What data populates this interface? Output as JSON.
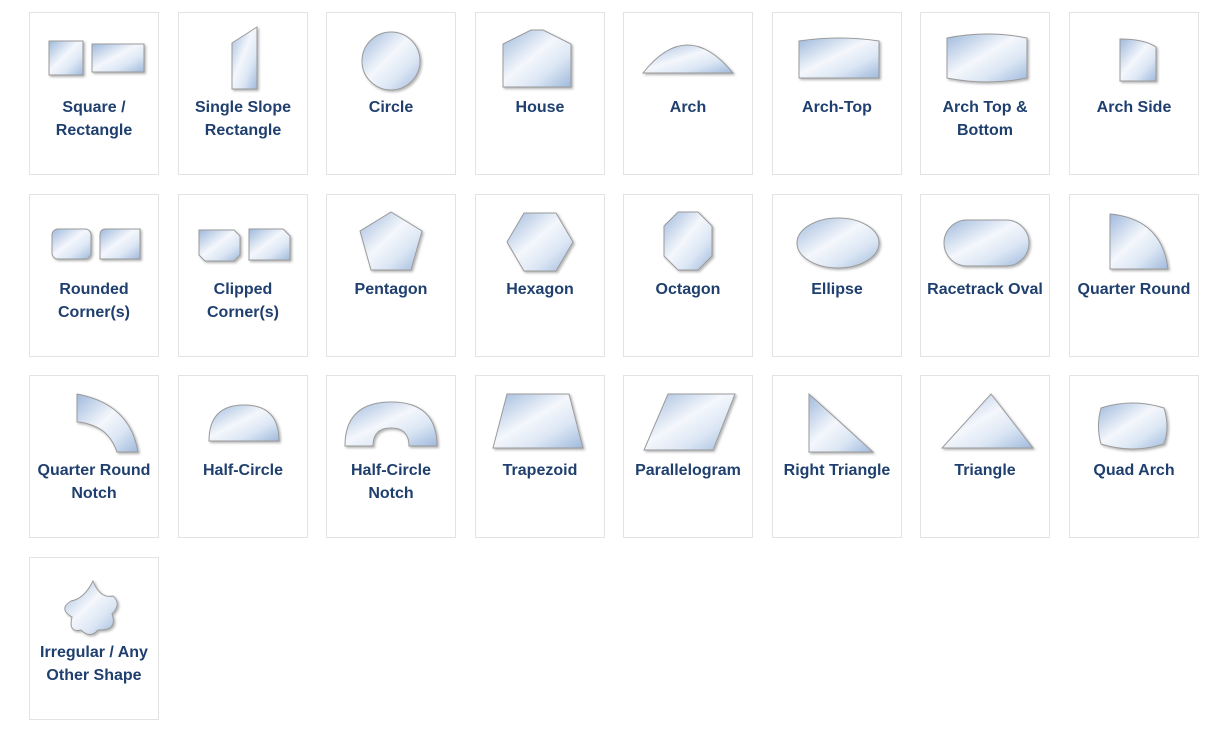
{
  "colors": {
    "label": "#1f3f6e",
    "glass_light": "#f4f7fc",
    "glass_mid": "#dbe6f4",
    "glass_dark": "#9fb9dc",
    "outline": "#9a9a9a"
  },
  "shapes": [
    {
      "id": "square-rectangle",
      "label_lines": [
        "Square /",
        "Rectangle"
      ],
      "icon": "square-rectangle-icon"
    },
    {
      "id": "single-slope-rectangle",
      "label_lines": [
        "Single Slope",
        "Rectangle"
      ],
      "icon": "single-slope-rectangle-icon"
    },
    {
      "id": "circle",
      "label_lines": [
        "Circle"
      ],
      "icon": "circle-icon"
    },
    {
      "id": "house",
      "label_lines": [
        "House"
      ],
      "icon": "house-icon"
    },
    {
      "id": "arch",
      "label_lines": [
        "Arch"
      ],
      "icon": "arch-icon"
    },
    {
      "id": "arch-top",
      "label_lines": [
        "Arch-Top"
      ],
      "icon": "arch-top-icon"
    },
    {
      "id": "arch-top-bottom",
      "label_lines": [
        "Arch Top &",
        "Bottom"
      ],
      "icon": "arch-top-bottom-icon"
    },
    {
      "id": "arch-side",
      "label_lines": [
        "Arch Side"
      ],
      "icon": "arch-side-icon"
    },
    {
      "id": "rounded-corners",
      "label_lines": [
        "Rounded",
        "Corner(s)"
      ],
      "icon": "rounded-corners-icon"
    },
    {
      "id": "clipped-corners",
      "label_lines": [
        "Clipped",
        "Corner(s)"
      ],
      "icon": "clipped-corners-icon"
    },
    {
      "id": "pentagon",
      "label_lines": [
        "Pentagon"
      ],
      "icon": "pentagon-icon"
    },
    {
      "id": "hexagon",
      "label_lines": [
        "Hexagon"
      ],
      "icon": "hexagon-icon"
    },
    {
      "id": "octagon",
      "label_lines": [
        "Octagon"
      ],
      "icon": "octagon-icon"
    },
    {
      "id": "ellipse",
      "label_lines": [
        "Ellipse"
      ],
      "icon": "ellipse-icon"
    },
    {
      "id": "racetrack-oval",
      "label_lines": [
        "Racetrack Oval"
      ],
      "icon": "racetrack-oval-icon"
    },
    {
      "id": "quarter-round",
      "label_lines": [
        "Quarter Round"
      ],
      "icon": "quarter-round-icon"
    },
    {
      "id": "quarter-round-notch",
      "label_lines": [
        "Quarter Round",
        "Notch"
      ],
      "icon": "quarter-round-notch-icon"
    },
    {
      "id": "half-circle",
      "label_lines": [
        "Half-Circle"
      ],
      "icon": "half-circle-icon"
    },
    {
      "id": "half-circle-notch",
      "label_lines": [
        "Half-Circle",
        "Notch"
      ],
      "icon": "half-circle-notch-icon"
    },
    {
      "id": "trapezoid",
      "label_lines": [
        "Trapezoid"
      ],
      "icon": "trapezoid-icon"
    },
    {
      "id": "parallelogram",
      "label_lines": [
        "Parallelogram"
      ],
      "icon": "parallelogram-icon"
    },
    {
      "id": "right-triangle",
      "label_lines": [
        "Right Triangle"
      ],
      "icon": "right-triangle-icon"
    },
    {
      "id": "triangle",
      "label_lines": [
        "Triangle"
      ],
      "icon": "triangle-icon"
    },
    {
      "id": "quad-arch",
      "label_lines": [
        "Quad Arch"
      ],
      "icon": "quad-arch-icon"
    },
    {
      "id": "irregular",
      "label_lines": [
        "Irregular / Any",
        "Other Shape"
      ],
      "icon": "irregular-shape-icon"
    }
  ]
}
